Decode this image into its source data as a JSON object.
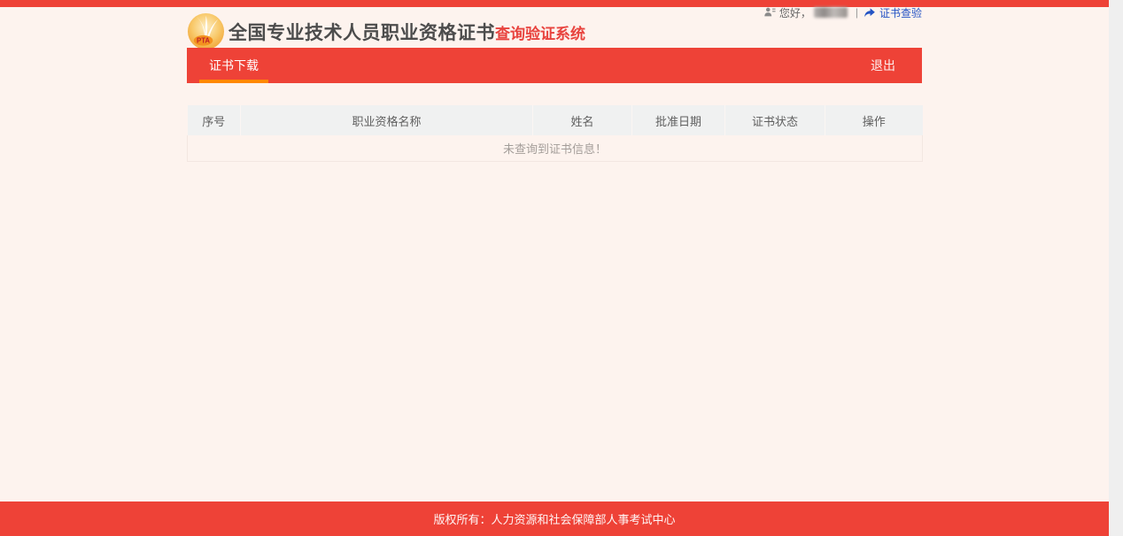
{
  "page": {
    "background": "#fdf3ee",
    "accent_red": "#ee4237",
    "tab_underline_orange": "#ff8800",
    "link_blue": "#2353c4"
  },
  "header": {
    "logo_text": "PTA",
    "title_main": "全国专业技术人员职业资格证书",
    "title_accent": "查询验证系统",
    "greeting_prefix": "您好，",
    "greeting_divider": "|",
    "verify_link_label": "证书查验"
  },
  "nav": {
    "tabs": [
      {
        "label": "证书下载",
        "active": true
      }
    ],
    "logout_label": "退出"
  },
  "table": {
    "columns": [
      "序号",
      "职业资格名称",
      "姓名",
      "批准日期",
      "证书状态",
      "操作"
    ],
    "rows": [],
    "empty_message": "未查询到证书信息！"
  },
  "footer": {
    "copyright": "版权所有：人力资源和社会保障部人事考试中心"
  }
}
